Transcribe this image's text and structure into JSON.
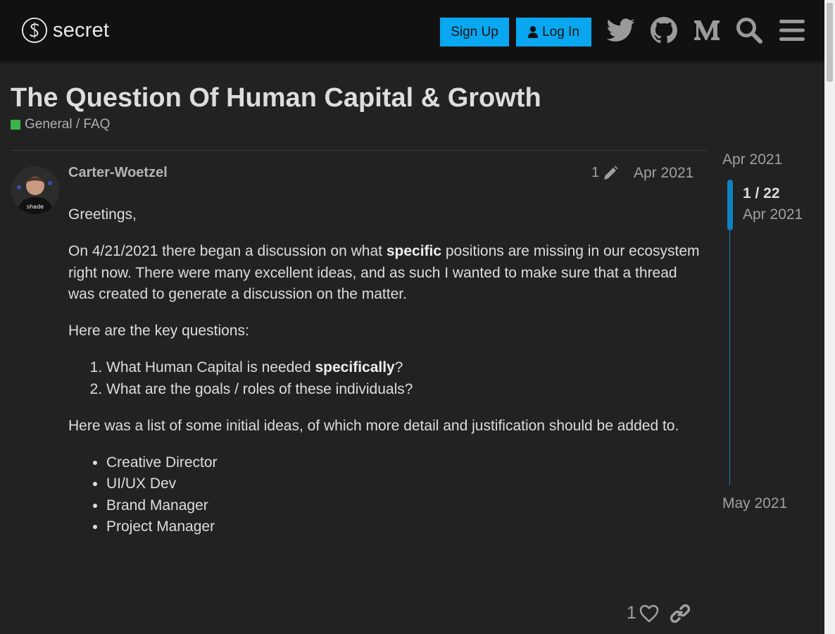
{
  "header": {
    "logo_text": "secret",
    "signup_label": "Sign Up",
    "login_label": "Log In",
    "icons": [
      "twitter-icon",
      "github-icon",
      "medium-icon",
      "search-icon",
      "hamburger-menu-icon"
    ],
    "accent_color": "#08a7f0"
  },
  "topic": {
    "title": "The Question Of Human Capital & Growth",
    "category": "General / FAQ",
    "category_color": "#3ab54a"
  },
  "post": {
    "username": "Carter-Woetzel",
    "edit_count": "1",
    "date": "Apr 2021",
    "greeting": "Greetings,",
    "intro_before": "On 4/21/2021 there began a discussion on what ",
    "intro_bold": "specific",
    "intro_after": " positions are missing in our ecosystem right now. There were many excellent ideas, and as such I wanted to make sure that a thread was created to generate a discussion on the matter.",
    "questions_heading": "Here are the key questions:",
    "q1_before": "What Human Capital is needed ",
    "q1_bold": "specifically",
    "q1_after": "?",
    "q2": "What are the goals / roles of these individuals?",
    "ideas_heading": "Here was a list of some initial ideas, of which more detail and justification should be added to.",
    "ideas": [
      "Creative Director",
      "UI/UX Dev",
      "Brand Manager",
      "Project Manager"
    ],
    "like_count": "1"
  },
  "timeline": {
    "start_date": "Apr 2021",
    "position": "1 / 22",
    "position_date": "Apr 2021",
    "end_date": "May 2021"
  }
}
